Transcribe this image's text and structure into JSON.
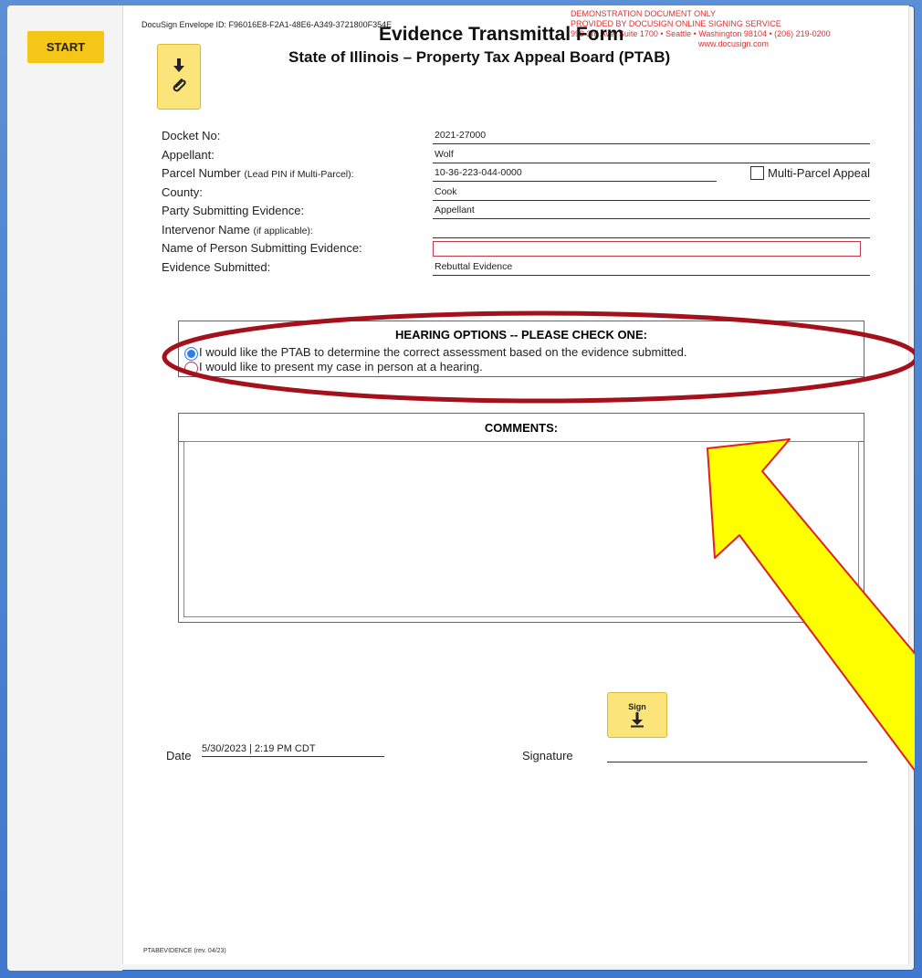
{
  "sidebar": {
    "start_label": "START"
  },
  "header": {
    "envelope_id": "DocuSign Envelope ID: F96016E8-F2A1-48E6-A349-3721800F354E",
    "demo_line1": "DEMONSTRATION DOCUMENT ONLY",
    "demo_line2": "PROVIDED BY DOCUSIGN ONLINE SIGNING SERVICE",
    "demo_line3": "999 3rd Ave, Suite 1700 • Seattle • Washington 98104 • (206) 219-0200",
    "demo_line4": "www.docusign.com",
    "title": "Evidence Transmittal Form",
    "subtitle": "State of Illinois – Property Tax Appeal Board (PTAB)"
  },
  "fields": {
    "docket_label": "Docket No:",
    "docket_value": "2021-27000",
    "appellant_label": "Appellant:",
    "appellant_value": "Wolf",
    "parcel_label": "Parcel Number",
    "parcel_label_small": "(Lead PIN if Multi-Parcel):",
    "parcel_value": "10-36-223-044-0000",
    "multi_parcel_label": "Multi-Parcel Appeal",
    "county_label": "County:",
    "county_value": "Cook",
    "party_label": "Party Submitting Evidence:",
    "party_value": "Appellant",
    "intervenor_label": "Intervenor Name",
    "intervenor_label_small": "(if applicable):",
    "person_label": "Name of Person Submitting Evidence:",
    "evidence_label": "Evidence Submitted:",
    "evidence_value": "Rebuttal Evidence"
  },
  "hearing": {
    "title": "HEARING OPTIONS -- PLEASE CHECK ONE:",
    "option1": "I would like the PTAB to determine the correct assessment based on the evidence submitted.",
    "option2": "I would like to present my case in person at a hearing.",
    "selected": 1
  },
  "comments": {
    "title": "COMMENTS:"
  },
  "signing": {
    "date_label": "Date",
    "date_value": "5/30/2023 | 2:19 PM CDT",
    "signature_label": "Signature",
    "sign_button_label": "Sign"
  },
  "footer": {
    "form_id": "PTABEVIDENCE (rev. 04/23)"
  },
  "colors": {
    "highlight_ellipse": "#a4111b",
    "arrow_fill": "#ffff00",
    "arrow_stroke": "#e02020",
    "button_yellow": "#f5c518"
  },
  "icons": {
    "attach": "paperclip-icon",
    "download": "arrow-down-icon"
  }
}
